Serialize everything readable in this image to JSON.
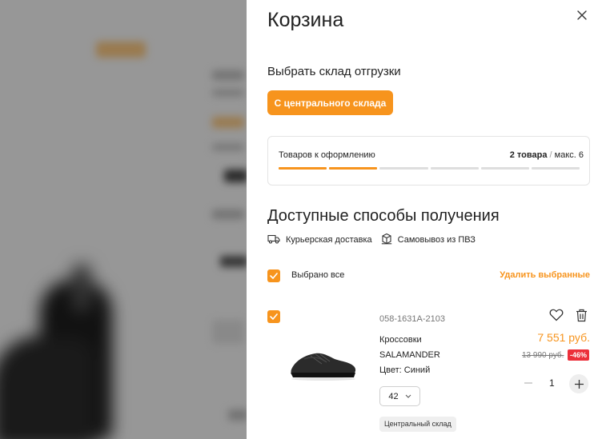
{
  "cart": {
    "title": "Корзина",
    "warehouse": {
      "label": "Выбрать склад отгрузки",
      "button": "С центрального склада"
    },
    "progress": {
      "label": "Товаров к оформлению",
      "count": "2 товара",
      "separator": " / ",
      "max": "макс. 6",
      "filled": 2,
      "total": 6
    },
    "delivery": {
      "title": "Доступные способы получения",
      "methods": [
        {
          "label": "Курьерская доставка",
          "icon": "truck-icon"
        },
        {
          "label": "Самовывоз из ПВЗ",
          "icon": "pickup-point-icon"
        }
      ]
    },
    "select_all": {
      "label": "Выбрано все",
      "checked": true
    },
    "delete_selected": "Удалить выбранные",
    "items": [
      {
        "sku": "058-1631A-2103",
        "name_line1": "Кроссовки",
        "name_line2": "SALAMANDER",
        "color": "Цвет: Синий",
        "size": "42",
        "stock": "Центральный склад",
        "price": "7 551 руб.",
        "old_price": "13 990 руб.",
        "discount": "-46%",
        "quantity": "1",
        "checked": true
      }
    ]
  },
  "colors": {
    "accent": "#f7941d",
    "discount": "#ec2f3a"
  }
}
